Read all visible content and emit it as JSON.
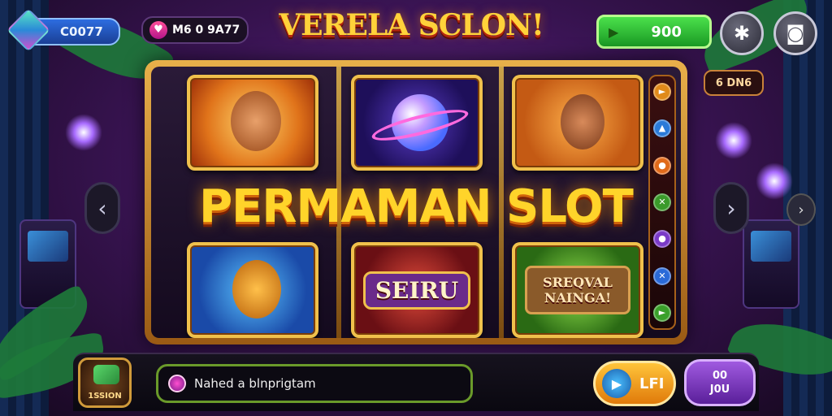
{
  "header": {
    "coins_value": "C0077",
    "level_text": "M6 0 9A77",
    "game_title": "VERELA SCLON!",
    "balance_value": "900",
    "bet_text": "6 DN6"
  },
  "reels": {
    "banner_title": "PERMAMAN SLOT",
    "tile_labels": [
      "SEIRU",
      "SREQVAL NAINGA!"
    ]
  },
  "footer": {
    "session_label": "1SSION",
    "message_text": "Nahed a blnprigtam",
    "spin_label": "LFI",
    "auto_line1": "00",
    "auto_line2": "J0U"
  },
  "colors": {
    "accent_gold": "#ffd42a",
    "balance_green": "#1a9a24",
    "frame_gold": "#e8b04a",
    "auto_purple": "#5a1f9a"
  },
  "icons": {
    "coins": "gem-icon",
    "level": "heart-icon",
    "balance": "arrow-icon",
    "tools": "tools-icon",
    "camera": "camera-icon",
    "spin": "play-icon",
    "message": "chat-icon"
  }
}
